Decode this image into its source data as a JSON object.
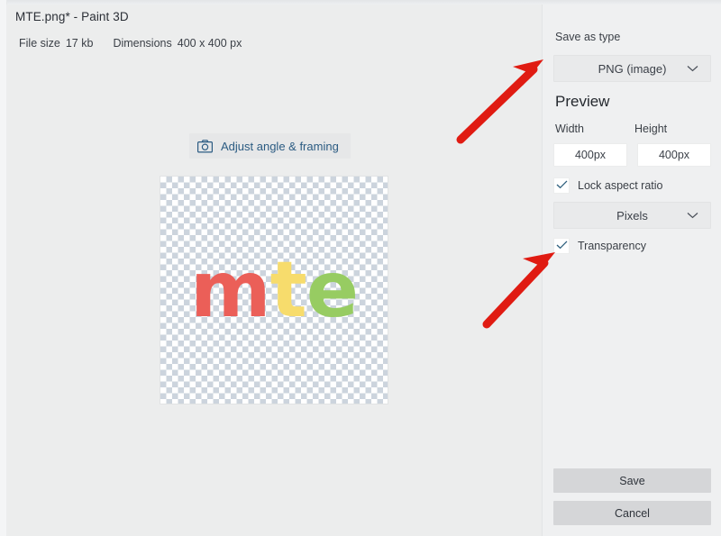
{
  "window": {
    "title": "MTE.png* - Paint 3D",
    "controls": [
      {
        "name": "minimize",
        "glyph": "minimize-icon"
      },
      {
        "name": "maximize",
        "glyph": "maximize-icon"
      },
      {
        "name": "close",
        "glyph": "close-icon"
      }
    ]
  },
  "fileinfo": {
    "filesize_label": "File size",
    "filesize_value": "17 kb",
    "dimensions_label": "Dimensions",
    "dimensions_value": "400 x 400 px"
  },
  "canvas": {
    "adjust_button_label": "Adjust angle & framing",
    "adjust_button_icon": "camera-icon",
    "image": {
      "alt": "mte logo on transparent checkerboard",
      "letters": [
        {
          "char": "m",
          "color": "#eb5f58"
        },
        {
          "char": "t",
          "color": "#f7dc6c"
        },
        {
          "char": "e",
          "color": "#97cc62"
        }
      ]
    }
  },
  "panel": {
    "save_as_type_label": "Save as type",
    "file_type_value": "PNG (image)",
    "file_type_options": [
      "PNG (image)"
    ],
    "preview_heading": "Preview",
    "width_label": "Width",
    "height_label": "Height",
    "width_value": "400px",
    "height_value": "400px",
    "width_placeholder": "400px",
    "height_placeholder": "400px",
    "lock_aspect_label": "Lock aspect ratio",
    "lock_aspect_checked": true,
    "units_value": "Pixels",
    "units_options": [
      "Pixels"
    ],
    "transparency_label": "Transparency",
    "transparency_checked": true,
    "save_label": "Save",
    "cancel_label": "Cancel"
  },
  "annotations": [
    {
      "name": "arrow-to-file-type-dropdown",
      "color": "#e01b12",
      "points_to": "PNG (image)"
    },
    {
      "name": "arrow-to-transparency-checkbox",
      "color": "#e01b12",
      "points_to": "Transparency"
    }
  ],
  "colors": {
    "window_bg": "#eceded",
    "panel_bg": "#eff0f1",
    "accent_link": "#2b5b82",
    "check_color": "#2e5f7d",
    "annotation_red": "#e01b12"
  }
}
